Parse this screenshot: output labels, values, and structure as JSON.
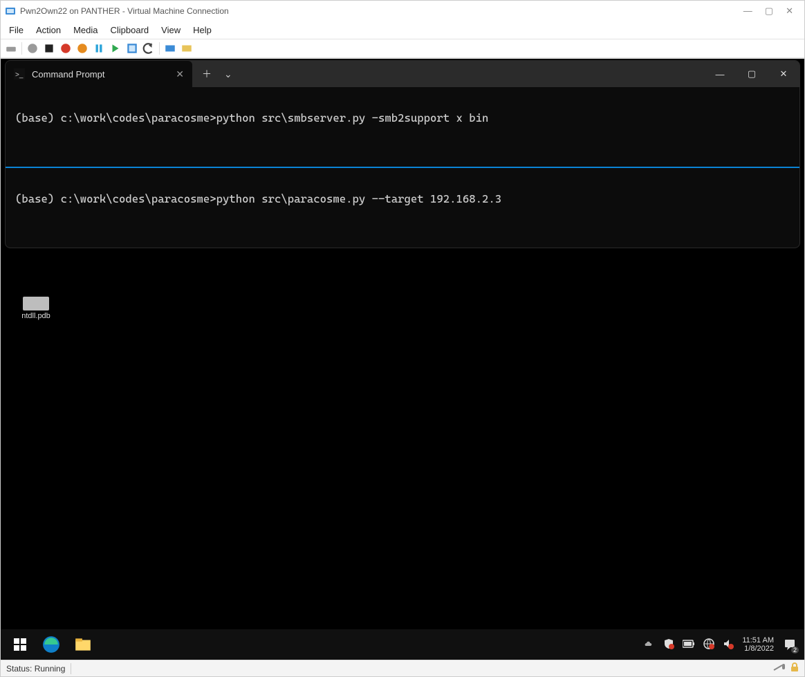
{
  "vm": {
    "title": "Pwn2Own22 on PANTHER - Virtual Machine Connection",
    "menu": [
      "File",
      "Action",
      "Media",
      "Clipboard",
      "View",
      "Help"
    ],
    "status": "Status: Running"
  },
  "terminal": {
    "tab_title": "Command Prompt",
    "pane1": "(base) c:\\work\\codes\\paracosme>python src\\smbserver.py -smb2support x bin",
    "pane2": "(base) c:\\work\\codes\\paracosme>python src\\paracosme.py --target 192.168.2.3"
  },
  "desktop": {
    "icon1_label": "ntdll.pdb"
  },
  "taskbar": {
    "time": "11:51 AM",
    "date": "1/8/2022",
    "notif_count": "2"
  }
}
